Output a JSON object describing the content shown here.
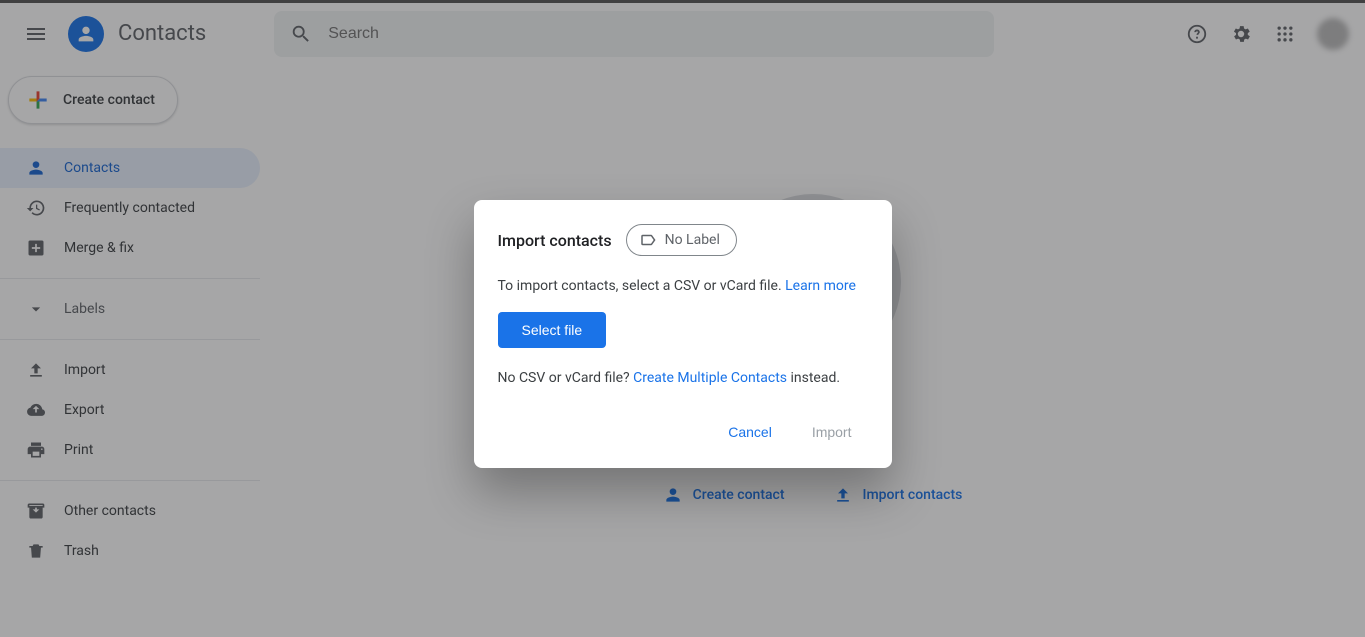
{
  "header": {
    "app_title": "Contacts",
    "search_placeholder": "Search"
  },
  "sidebar": {
    "create_label": "Create contact",
    "nav": [
      {
        "label": "Contacts"
      },
      {
        "label": "Frequently contacted"
      },
      {
        "label": "Merge & fix"
      }
    ],
    "labels_header": "Labels",
    "tools": [
      {
        "label": "Import"
      },
      {
        "label": "Export"
      },
      {
        "label": "Print"
      }
    ],
    "other": [
      {
        "label": "Other contacts"
      },
      {
        "label": "Trash"
      }
    ]
  },
  "empty_state": {
    "create_label": "Create contact",
    "import_label": "Import contacts"
  },
  "dialog": {
    "title": "Import contacts",
    "chip_label": "No Label",
    "description": "To import contacts, select a CSV or vCard file. ",
    "learn_more": "Learn more",
    "select_file": "Select file",
    "no_file_prefix": "No CSV or vCard file? ",
    "create_multiple": "Create Multiple Contacts",
    "no_file_suffix": " instead.",
    "cancel": "Cancel",
    "import": "Import"
  }
}
